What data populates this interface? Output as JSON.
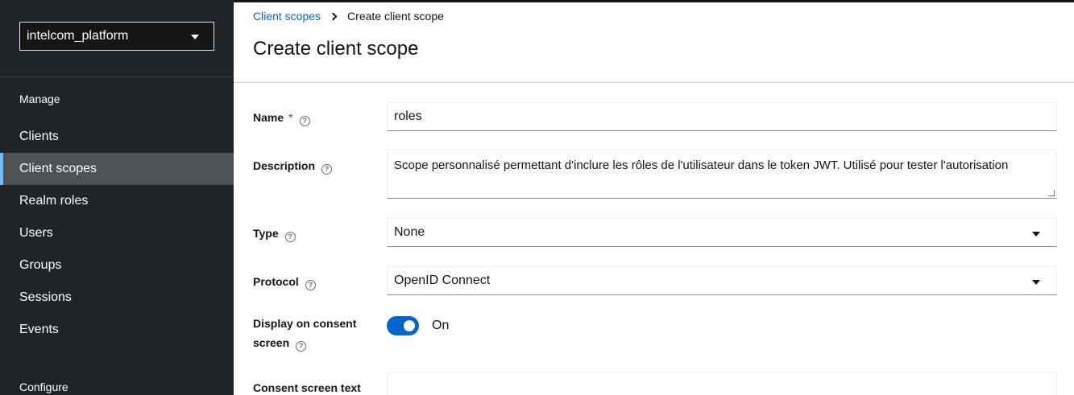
{
  "sidebar": {
    "realm": "intelcom_platform",
    "manage_label": "Manage",
    "items": [
      {
        "label": "Clients"
      },
      {
        "label": "Client scopes"
      },
      {
        "label": "Realm roles"
      },
      {
        "label": "Users"
      },
      {
        "label": "Groups"
      },
      {
        "label": "Sessions"
      },
      {
        "label": "Events"
      }
    ],
    "configure_label": "Configure"
  },
  "breadcrumb": {
    "parent": "Client scopes",
    "current": "Create client scope"
  },
  "page": {
    "title": "Create client scope"
  },
  "form": {
    "name": {
      "label": "Name",
      "required_mark": "*",
      "value": "roles"
    },
    "description": {
      "label": "Description",
      "value": "Scope personnalisé permettant d'inclure les rôles de l'utilisateur dans le token JWT. Utilisé pour tester l'autorisation"
    },
    "type": {
      "label": "Type",
      "value": "None"
    },
    "protocol": {
      "label": "Protocol",
      "value": "OpenID Connect"
    },
    "consent": {
      "label_line1": "Display on consent",
      "label_line2": "screen",
      "toggle_text": "On",
      "enabled": true
    },
    "consent_text": {
      "label": "Consent screen text",
      "value": ""
    }
  },
  "colors": {
    "accent": "#0066cc",
    "sidebar_bg": "#212427",
    "active_bar": "#73bcf7"
  },
  "icons": {
    "help": "help-circle-icon",
    "caret": "caret-down-icon",
    "breadcrumb_sep": "chevron-right-icon"
  }
}
